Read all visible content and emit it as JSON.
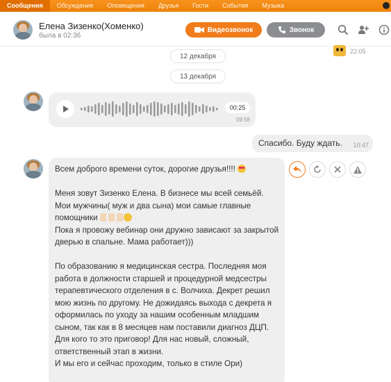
{
  "nav": {
    "tabs": [
      "Сообщения",
      "Обсуждения",
      "Оповещения",
      "Друзья",
      "Гости",
      "События",
      "Музыка"
    ]
  },
  "header": {
    "name": "Елена Зизенко(Хоменко)",
    "status": "была в 02:36",
    "video_label": "Видеозвонок",
    "call_label": "Звонок"
  },
  "colors": {
    "accent": "#f07c1c",
    "nav": "#ee8208",
    "bubble": "#efefef"
  },
  "chat": {
    "prev_message_time": "22:05",
    "dates": [
      "12 декабря",
      "13 декабря"
    ],
    "voice": {
      "duration": "00:25",
      "time": "09:58"
    },
    "my_message": {
      "text": "Спасибо. Буду ждать.",
      "time": "10:47"
    },
    "long_message": {
      "paragraphs": [
        "Всем доброго времени суток, дорогие друзья!!!!",
        "Меня зовут Зизенко Елена. В бизнесе мы всей семьёй. Мои мужчины( муж и два сына) мои самые главные помощники",
        "Пока я провожу вебинар они дружно зависают за закрытой дверью в спальне. Мама работает)))",
        "По образованию я медицинская сестра. Последняя моя работа в должности старшей и процедурной медсестры терапевтического отделения в с. Волчиха. Декрет решил мою жизнь по другому. Не дожидаясь выхода с декрета я оформилась по уходу за нашим особенным младшим сыном, так как в 8 месяцев нам поставили диагноз ДЦП.",
        "Для кого то это приговор! Для  нас новый, сложный, ответственный этап в жизни.",
        "И мы его и сейчас проходим, только в стиле Ори)"
      ]
    }
  },
  "icons": [
    "video-camera-icon",
    "phone-icon",
    "search-icon",
    "add-user-icon",
    "info-icon",
    "reply-icon",
    "forward-icon",
    "close-icon",
    "warning-icon",
    "play-icon"
  ]
}
